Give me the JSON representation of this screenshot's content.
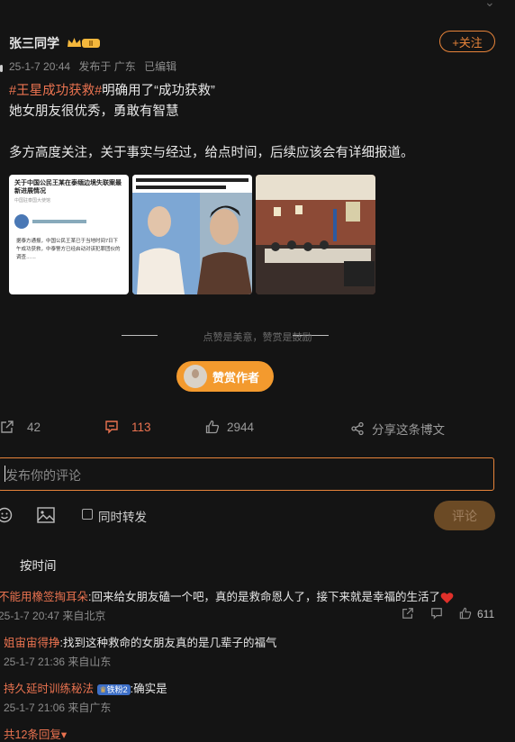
{
  "post": {
    "username": "张三同学",
    "follow_label": "+关注",
    "time": "25-1-7 20:44",
    "source": "发布于 广东",
    "edited": "已编辑",
    "hashtag": "#王星成功获救#",
    "line1_rest": "明确用了“成功获救”",
    "line2": "她女朋友很优秀，勇敢有智慧",
    "line3": "多方高度关注，关于事实与经过，给点时间，后续应该会有详细报道。"
  },
  "images": {
    "img1_title": "关于中国公民王某在泰缅边境失联案最新进展情况",
    "img1_source": "中国驻泰国大使馆",
    "img1_body": "据泰方通报，中国公民王某已于当地时间7日下午成功获救，中泰警方已经启动对该犯罪团伙的调查……"
  },
  "reward": {
    "divider_text": "点赞是美意，赞赏是鼓励",
    "button_label": "赞赏作者"
  },
  "actions": {
    "repost_count": "42",
    "comment_count": "113",
    "like_count": "2944",
    "share_label": "分享这条博文"
  },
  "composer": {
    "placeholder": "发布你的评论",
    "repost_label": "同时转发",
    "submit_label": "评论"
  },
  "comments": {
    "sort_label": "按时间",
    "items": [
      {
        "user": "不能用橡签掏耳朵",
        "text": ":回来给女朋友磕一个吧，真的是救命恩人了，接下来就是幸福的生活了",
        "time": "25-1-7 20:47 来自北京",
        "likes": "611"
      },
      {
        "user": "姐宙宙得挣",
        "text": ":找到这种救命的女朋友真的是几辈子的福气",
        "time": "25-1-7 21:36 来自山东"
      },
      {
        "user": "持久延时训练秘法",
        "badge": "铁粉2",
        "text": ":确实是",
        "time": "25-1-7 21:06 来自广东"
      }
    ],
    "more_replies": "共12条回复"
  },
  "colors": {
    "accent": "#eb7350",
    "follow": "#e8843a",
    "reward": "#f39a2e",
    "bg": "#141414"
  }
}
